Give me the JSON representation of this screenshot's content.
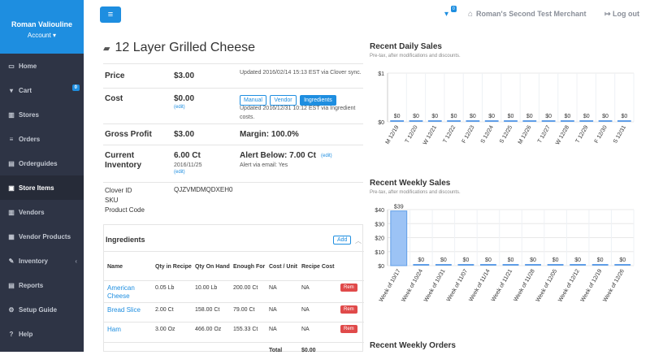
{
  "sidebar": {
    "user_name": "Roman Valiouline",
    "account": "Account ▾",
    "items": [
      {
        "label": "Home",
        "icon": "▭"
      },
      {
        "label": "Cart",
        "icon": "▾",
        "badge": "0"
      },
      {
        "label": "Stores",
        "icon": "▥"
      },
      {
        "label": "Orders",
        "icon": "≡"
      },
      {
        "label": "Orderguides",
        "icon": "▤"
      },
      {
        "label": "Store Items",
        "icon": "▣",
        "active": true
      },
      {
        "label": "Vendors",
        "icon": "▥"
      },
      {
        "label": "Vendor Products",
        "icon": "▦"
      },
      {
        "label": "Inventory",
        "icon": "✎",
        "chevron": "‹"
      },
      {
        "label": "Reports",
        "icon": "▤"
      },
      {
        "label": "Setup Guide",
        "icon": "⚙"
      },
      {
        "label": "Help",
        "icon": "?"
      }
    ]
  },
  "topbar": {
    "menu_icon": "≡",
    "cart_icon": "▾",
    "cart_count": "0",
    "merchant": "Roman's Second Test Merchant",
    "logout": "Log out"
  },
  "item": {
    "title": "12 Layer Grilled Cheese",
    "price_label": "Price",
    "price": "$3.00",
    "price_note": "Updated 2016/02/14 15:13 EST via Clover sync.",
    "cost_label": "Cost",
    "cost": "$0.00",
    "edit": "(edit)",
    "cost_buttons": [
      "Manual",
      "Vendor",
      "Ingredients"
    ],
    "cost_note": "Updated 2016/12/31 10:12 EST via Ingredient costs.",
    "gp_label": "Gross Profit",
    "gp": "$3.00",
    "margin": "Margin: 100.0%",
    "inv_label": "Current Inventory",
    "inv": "6.00 Ct",
    "inv_date": "2016/11/25",
    "alert": "Alert Below: 7.00 Ct",
    "alert_email": "Alert via email: Yes",
    "clover_label": "Clover ID",
    "clover_id": "QJZVMDMQDXEH0",
    "sku_label": "SKU",
    "product_code_label": "Product Code"
  },
  "ingredients": {
    "title": "Ingredients",
    "add": "Add",
    "collapse": "︿",
    "headers": [
      "Name",
      "Qty in Recipe",
      "Qty On Hand",
      "Enough For",
      "Cost / Unit",
      "Recipe Cost"
    ],
    "rows": [
      {
        "name": "American Cheese",
        "qty": "0.05 Lb",
        "onhand": "10.00 Lb",
        "enough": "200.00 Ct",
        "unit": "NA",
        "cost": "NA",
        "rem": "Rem"
      },
      {
        "name": "Bread Slice",
        "qty": "2.00 Ct",
        "onhand": "158.00 Ct",
        "enough": "79.00 Ct",
        "unit": "NA",
        "cost": "NA",
        "rem": "Rem"
      },
      {
        "name": "Ham",
        "qty": "3.00 Oz",
        "onhand": "466.00 Oz",
        "enough": "155.33 Ct",
        "unit": "NA",
        "cost": "NA",
        "rem": "Rem"
      }
    ],
    "total_label": "Total",
    "total": "$0.00"
  },
  "charts": {
    "daily_title": "Recent Daily Sales",
    "weekly_title": "Recent Weekly Sales",
    "orders_title": "Recent Weekly Orders",
    "subtitle": "Pre-tax, after modifications and discounts."
  },
  "chart_data": [
    {
      "type": "bar",
      "title": "Recent Daily Sales",
      "subtitle": "Pre-tax, after modifications and discounts.",
      "categories": [
        "M 12/19",
        "T 12/20",
        "W 12/21",
        "T 12/22",
        "F 12/23",
        "S 12/24",
        "S 12/25",
        "M 12/26",
        "T 12/27",
        "W 12/28",
        "T 12/29",
        "F 12/30",
        "S 12/31"
      ],
      "values": [
        0,
        0,
        0,
        0,
        0,
        0,
        0,
        0,
        0,
        0,
        0,
        0,
        0
      ],
      "labels": [
        "$0",
        "$0",
        "$0",
        "$0",
        "$0",
        "$0",
        "$0",
        "$0",
        "$0",
        "$0",
        "$0",
        "$0",
        "$0"
      ],
      "yticks": [
        "$0",
        "$1"
      ],
      "ylim": [
        0,
        1
      ]
    },
    {
      "type": "bar",
      "title": "Recent Weekly Sales",
      "subtitle": "Pre-tax, after modifications and discounts.",
      "categories": [
        "Week of 10/17",
        "Week of 10/24",
        "Week of 10/31",
        "Week of 11/07",
        "Week of 11/14",
        "Week of 11/21",
        "Week of 11/28",
        "Week of 12/05",
        "Week of 12/12",
        "Week of 12/19",
        "Week of 12/26"
      ],
      "values": [
        39,
        0,
        0,
        0,
        0,
        0,
        0,
        0,
        0,
        0,
        0
      ],
      "labels": [
        "$39",
        "$0",
        "$0",
        "$0",
        "$0",
        "$0",
        "$0",
        "$0",
        "$0",
        "$0",
        "$0"
      ],
      "yticks": [
        "$0",
        "$10",
        "$20",
        "$30",
        "$40"
      ],
      "ylim": [
        0,
        40
      ]
    }
  ]
}
